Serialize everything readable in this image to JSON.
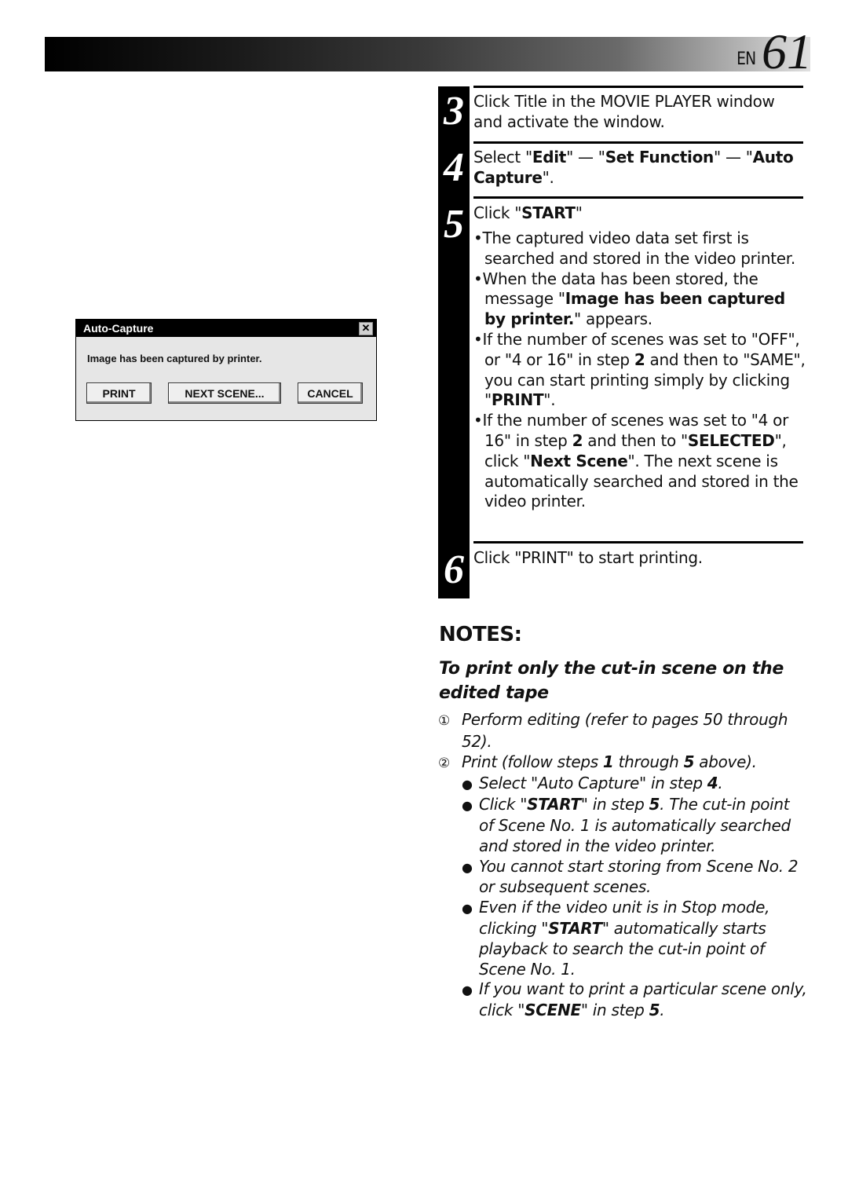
{
  "header": {
    "language": "EN",
    "page_number": "61"
  },
  "dialog": {
    "title": "Auto-Capture",
    "close_icon": "close-x-icon",
    "message": "Image has been captured by printer.",
    "buttons": {
      "print": "PRINT",
      "next_scene": "NEXT SCENE...",
      "cancel": "CANCEL"
    }
  },
  "steps": [
    {
      "number": "3",
      "parts": [
        {
          "t": "Click Title in the MOVIE PLAYER window and activate the window."
        }
      ]
    },
    {
      "number": "4",
      "parts": [
        {
          "t": "Select \""
        },
        {
          "b": "Edit"
        },
        {
          "t": "\" — \""
        },
        {
          "b": "Set Function"
        },
        {
          "t": "\" — \""
        },
        {
          "b": "Auto Capture"
        },
        {
          "t": "\"."
        }
      ]
    },
    {
      "number": "5",
      "parts": [
        {
          "t": "Click \""
        },
        {
          "b": "START"
        },
        {
          "t": "\""
        }
      ],
      "bullets": [
        [
          {
            "t": "•The captured video data set first is searched and stored in the video printer."
          }
        ],
        [
          {
            "t": "•When the data has been stored, the message \""
          },
          {
            "b": "Image has been captured by printer."
          },
          {
            "t": "\" appears."
          }
        ],
        [
          {
            "t": "•If the number of scenes was set to \"OFF\", or \"4 or 16\" in step "
          },
          {
            "b": "2"
          },
          {
            "t": " and then to \"SAME\", you can start printing simply by clicking \""
          },
          {
            "b": "PRINT"
          },
          {
            "t": "\"."
          }
        ],
        [
          {
            "t": "•If the number of scenes was set to \"4 or 16\" in step "
          },
          {
            "b": "2"
          },
          {
            "t": " and then to \""
          },
          {
            "b": "SELECTED"
          },
          {
            "t": "\", click \""
          },
          {
            "b": "Next Scene"
          },
          {
            "t": "\". The next scene is automatically searched and stored in the video printer."
          }
        ]
      ]
    },
    {
      "number": "6",
      "parts": [
        {
          "t": "Click \"PRINT\" to start printing."
        }
      ]
    }
  ],
  "notes": {
    "title": "NOTES:",
    "subtitle": "To print only the cut-in scene on the edited tape",
    "items": [
      {
        "marker": "①",
        "parts": [
          {
            "t": "Perform editing (refer to pages 50 through 52)."
          }
        ]
      },
      {
        "marker": "②",
        "parts": [
          {
            "t": "Print (follow steps "
          },
          {
            "b": "1"
          },
          {
            "t": " through "
          },
          {
            "b": "5"
          },
          {
            "t": " above)."
          }
        ]
      }
    ],
    "subitems": [
      [
        {
          "t": "Select \"Auto Capture\" in step "
        },
        {
          "b": "4"
        },
        {
          "t": "."
        }
      ],
      [
        {
          "t": "Click \""
        },
        {
          "b": "START"
        },
        {
          "t": "\" in step "
        },
        {
          "b": "5"
        },
        {
          "t": ". The cut-in point of Scene No. 1 is automatically searched and stored in the video printer."
        }
      ],
      [
        {
          "t": "You cannot start storing from Scene No. 2 or subsequent scenes."
        }
      ],
      [
        {
          "t": "Even if the video unit is in Stop mode, clicking \""
        },
        {
          "b": "START"
        },
        {
          "t": "\" automatically starts playback  to search the cut-in point of Scene No. 1."
        }
      ],
      [
        {
          "t": "If you want to print a particular scene only, click \""
        },
        {
          "b": "SCENE"
        },
        {
          "t": "\" in step "
        },
        {
          "b": "5"
        },
        {
          "t": "."
        }
      ]
    ]
  }
}
